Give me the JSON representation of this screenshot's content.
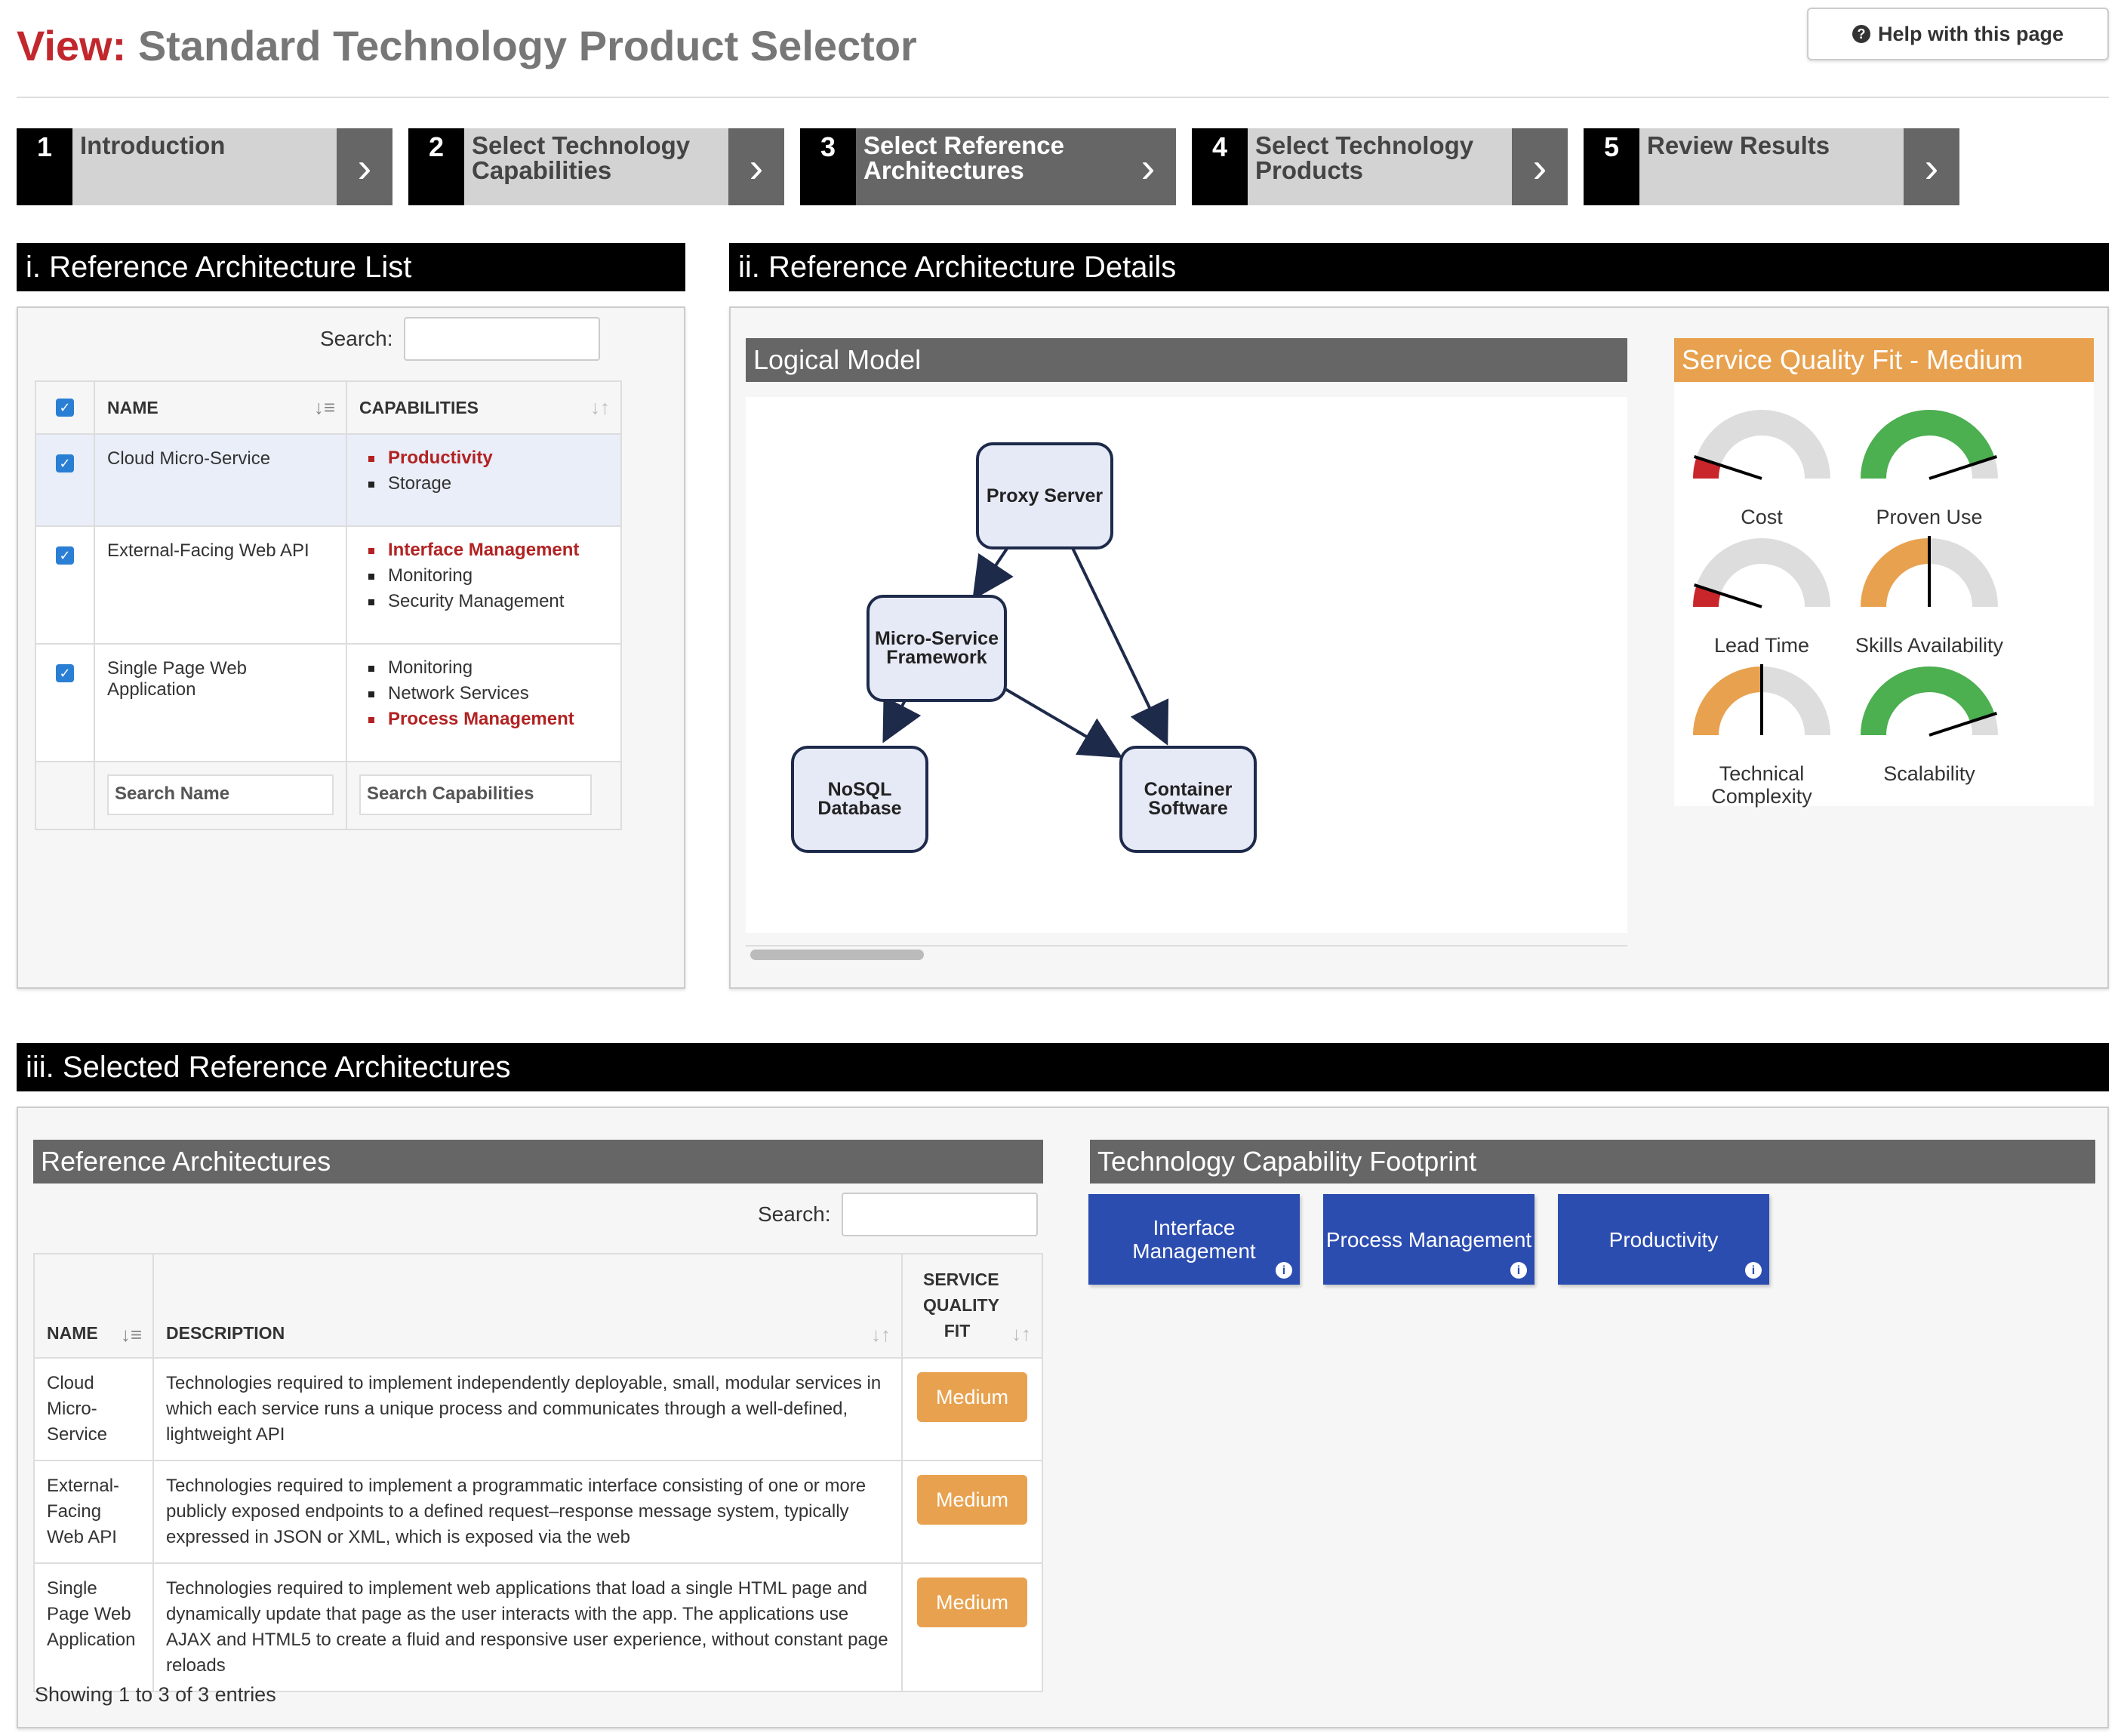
{
  "header": {
    "title_prefix": "View:",
    "title": "Standard Technology Product Selector",
    "help_label": "Help with this page"
  },
  "steps": [
    {
      "num": "1",
      "label": "Introduction"
    },
    {
      "num": "2",
      "label": "Select Technology Capabilities"
    },
    {
      "num": "3",
      "label": "Select Reference Architectures"
    },
    {
      "num": "4",
      "label": "Select Technology Products"
    },
    {
      "num": "5",
      "label": "Review Results"
    }
  ],
  "list_section": {
    "title": "i. Reference Architecture List",
    "search_label": "Search:",
    "col_name": "NAME",
    "col_caps": "CAPABILITIES",
    "rows": [
      {
        "name": "Cloud Micro-Service",
        "caps": [
          {
            "text": "Productivity",
            "hl": true
          },
          {
            "text": "Storage",
            "hl": false
          }
        ]
      },
      {
        "name": "External-Facing Web API",
        "caps": [
          {
            "text": "Interface Management",
            "hl": true
          },
          {
            "text": "Monitoring",
            "hl": false
          },
          {
            "text": "Security Management",
            "hl": false
          }
        ]
      },
      {
        "name": "Single Page Web Application",
        "caps": [
          {
            "text": "Monitoring",
            "hl": false
          },
          {
            "text": "Network Services",
            "hl": false
          },
          {
            "text": "Process Management",
            "hl": true
          }
        ]
      }
    ],
    "search_name_placeholder": "Search Name",
    "search_caps_placeholder": "Search Capabilities"
  },
  "details_section": {
    "title": "ii. Reference Architecture Details",
    "logical_model_title": "Logical Model",
    "nodes": {
      "proxy": "Proxy Server",
      "micro": "Micro-Service Framework",
      "nosql": "NoSQL Database",
      "container": "Container Software"
    },
    "fit_title": "Service Quality Fit - Medium",
    "gauges": [
      {
        "label": "Cost",
        "level": 0.1,
        "color": "#c9262c"
      },
      {
        "label": "Proven Use",
        "level": 0.9,
        "color": "#4caf50"
      },
      {
        "label": "Lead Time",
        "level": 0.1,
        "color": "#c9262c"
      },
      {
        "label": "Skills Availability",
        "level": 0.5,
        "color": "#e8a14e"
      },
      {
        "label": "Technical Complexity",
        "level": 0.5,
        "color": "#e8a14e"
      },
      {
        "label": "Scalability",
        "level": 0.9,
        "color": "#4caf50"
      }
    ]
  },
  "selected_section": {
    "title": "iii. Selected Reference Architectures",
    "ref_arch_title": "Reference Architectures",
    "search_label": "Search:",
    "col_name": "NAME",
    "col_desc": "DESCRIPTION",
    "col_fit": "SERVICE QUALITY FIT",
    "rows": [
      {
        "name": "Cloud Micro-Service",
        "desc": "Technologies required to implement independently deployable, small, modular services in which each service runs a unique process and communicates through a well-defined, lightweight API",
        "fit": "Medium"
      },
      {
        "name": "External-Facing Web API",
        "desc": "Technologies required to implement a programmatic interface consisting of one or more publicly exposed endpoints to a defined request–response message system, typically expressed in JSON or XML, which is exposed via the web",
        "fit": "Medium"
      },
      {
        "name": "Single Page Web Application",
        "desc": "Technologies required to implement web applications that load a single HTML page and dynamically update that page as the user interacts with the app. The applications use AJAX and HTML5 to create a fluid and responsive user experience, without constant page reloads",
        "fit": "Medium"
      }
    ],
    "showing": "Showing 1 to 3 of 3 entries",
    "footprint_title": "Technology Capability Footprint",
    "footprint": [
      "Interface Management",
      "Process Management",
      "Productivity"
    ]
  },
  "colors": {
    "accent_red": "#c1272d",
    "tile_blue": "#2c4db0",
    "medium_orange": "#e8a14e",
    "highlight_red": "#b22222"
  }
}
